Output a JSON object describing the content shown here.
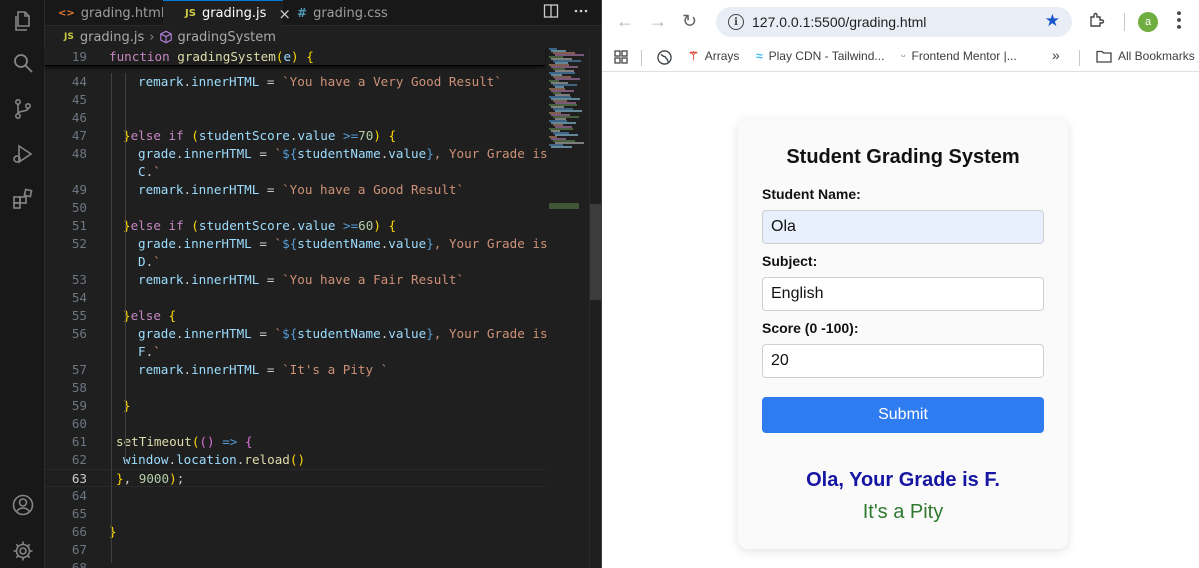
{
  "editor": {
    "tabs": [
      {
        "icon": "<>",
        "label": "grading.html",
        "active": false
      },
      {
        "icon": "JS",
        "label": "grading.js",
        "active": true
      },
      {
        "icon": "#",
        "label": "grading.css",
        "active": false
      }
    ],
    "close_glyph": "×",
    "breadcrumb": {
      "file_icon": "JS",
      "file": "grading.js",
      "symbol": "gradingSystem"
    },
    "sticky_line": {
      "number": "19",
      "code": "function gradingSystem(e) {"
    },
    "lines": [
      {
        "n": "44",
        "code": "remark.innerHTML = `You have a Very Good Result`"
      },
      {
        "n": "45",
        "code": ""
      },
      {
        "n": "46",
        "code": ""
      },
      {
        "n": "47",
        "code": "}else if (studentScore.value >=70) {"
      },
      {
        "n": "48",
        "code": "grade.innerHTML = `${studentName.value}, Your Grade is",
        "cont": "C.`"
      },
      {
        "n": "49",
        "code": "remark.innerHTML = `You have a Good Result`"
      },
      {
        "n": "50",
        "code": ""
      },
      {
        "n": "51",
        "code": "}else if (studentScore.value >=60) {"
      },
      {
        "n": "52",
        "code": "grade.innerHTML = `${studentName.value}, Your Grade is",
        "cont": "D.`"
      },
      {
        "n": "53",
        "code": "remark.innerHTML = `You have a Fair Result`"
      },
      {
        "n": "54",
        "code": ""
      },
      {
        "n": "55",
        "code": "}else {"
      },
      {
        "n": "56",
        "code": "grade.innerHTML = `${studentName.value}, Your Grade is",
        "cont": "F.`"
      },
      {
        "n": "57",
        "code": "remark.innerHTML = `It's a Pity `"
      },
      {
        "n": "58",
        "code": ""
      },
      {
        "n": "59",
        "code": "}"
      },
      {
        "n": "60",
        "code": ""
      },
      {
        "n": "61",
        "code": "setTimeout(() => {"
      },
      {
        "n": "62",
        "code": "window.location.reload()"
      },
      {
        "n": "63",
        "code": "}, 9000);"
      },
      {
        "n": "64",
        "code": ""
      },
      {
        "n": "65",
        "code": ""
      },
      {
        "n": "66",
        "code": "}"
      },
      {
        "n": "67",
        "code": ""
      },
      {
        "n": "68",
        "code": ""
      }
    ],
    "current_line": "63"
  },
  "browser": {
    "url": "127.0.0.1:5500/grading.html",
    "avatar_letter": "a",
    "bookmarks": [
      "Arrays",
      "Play CDN - Tailwind...",
      "Frontend Mentor |...",
      "All Bookmarks"
    ],
    "more_bookmarks": "»"
  },
  "form": {
    "title": "Student Grading System",
    "name_label": "Student Name:",
    "name_value": "Ola",
    "subject_label": "Subject:",
    "subject_value": "English",
    "score_label": "Score (0 -100):",
    "score_value": "20",
    "submit_label": "Submit",
    "grade_text": "Ola, Your Grade is F.",
    "remark_text": "It's a Pity"
  },
  "colors": {
    "editor_bg": "#1f1f1f",
    "accent": "#2f7cf0",
    "grade": "#1515a3",
    "remark": "#2f7a2f"
  }
}
